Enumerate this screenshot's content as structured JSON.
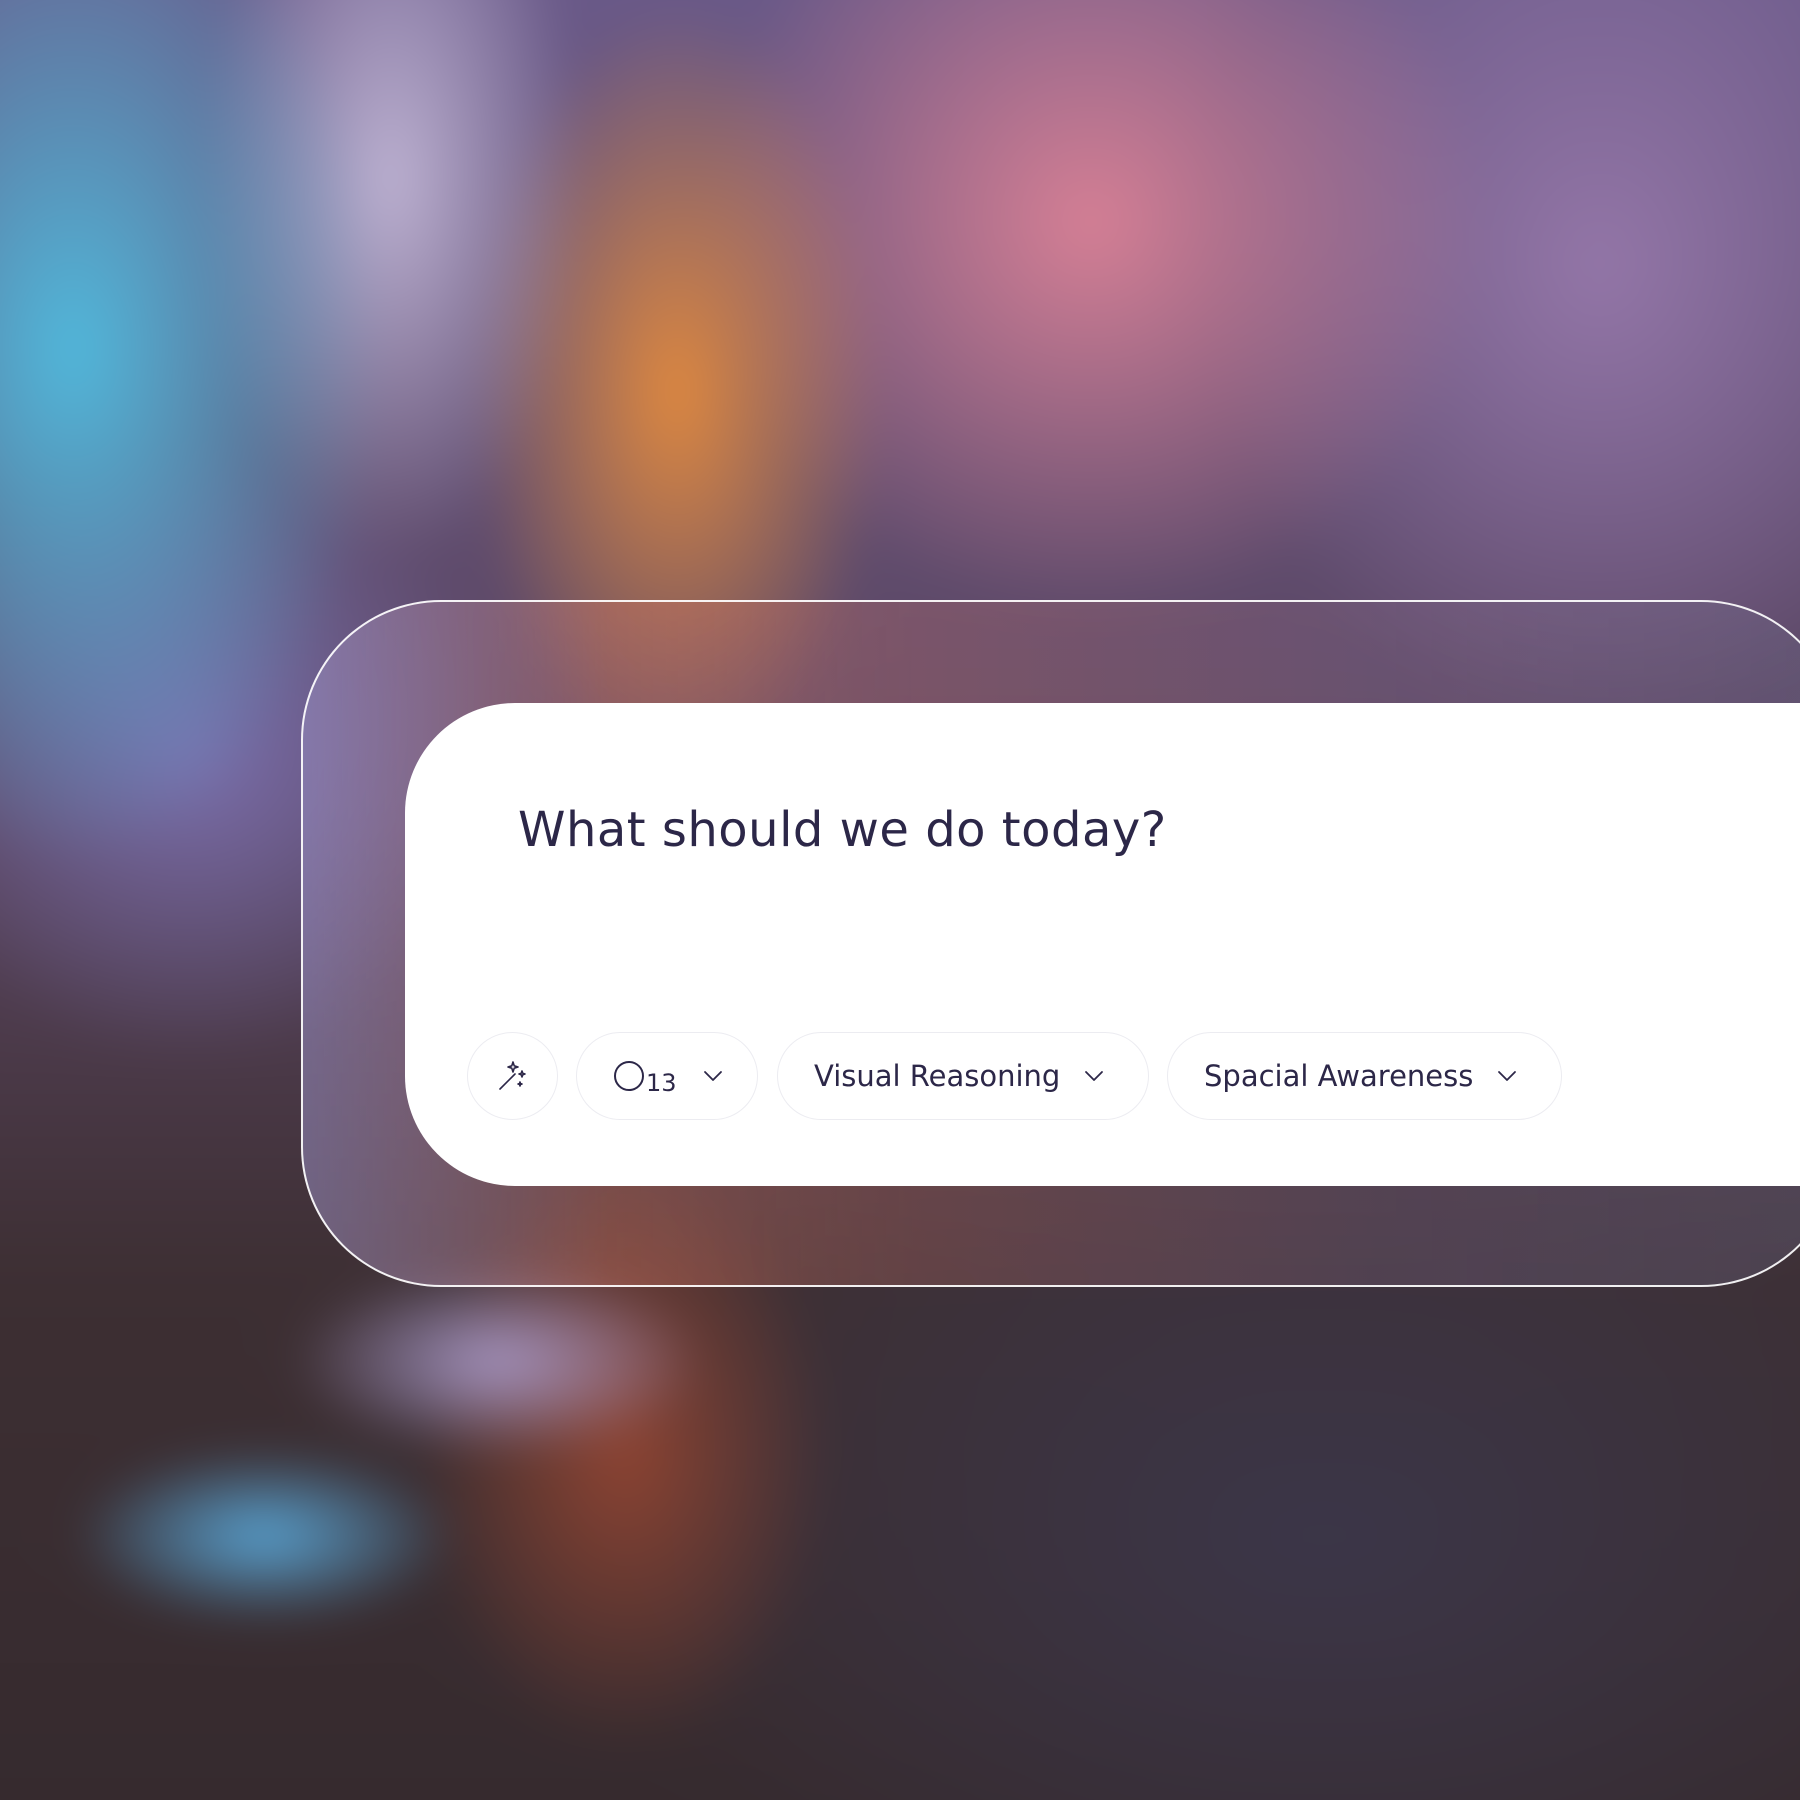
{
  "composer": {
    "prompt": "What should we do today?",
    "magic_icon": "magic-wand-icon",
    "model": {
      "icon": "circle-icon",
      "number": "13",
      "chevron_icon": "chevron-down-icon"
    },
    "chips": [
      {
        "label": "Visual Reasoning",
        "chevron_icon": "chevron-down-icon"
      },
      {
        "label": "Spacial Awareness",
        "chevron_icon": "chevron-down-icon"
      }
    ]
  },
  "colors": {
    "text": "#2c2748",
    "card": "#ffffff",
    "pill_border": "#ececf1",
    "frame_border": "#ffffff"
  }
}
